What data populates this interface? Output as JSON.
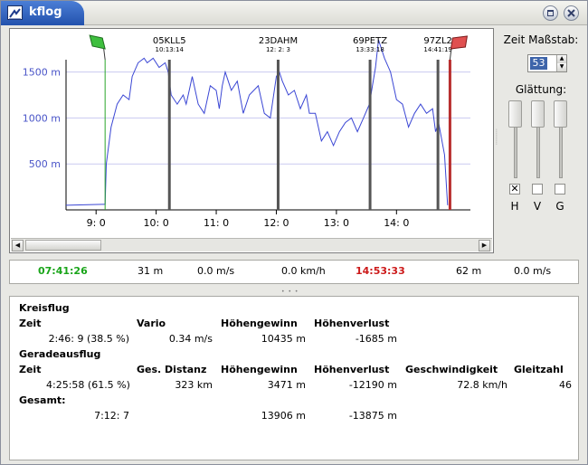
{
  "window": {
    "title": "kflog"
  },
  "chart_data": {
    "type": "line",
    "title": "",
    "y_ticks": [
      {
        "value": 500,
        "label": "500 m"
      },
      {
        "value": 1000,
        "label": "1000 m"
      },
      {
        "value": 1500,
        "label": "1500 m"
      }
    ],
    "x_ticks": [
      {
        "value": 9,
        "label": "9: 0"
      },
      {
        "value": 10,
        "label": "10: 0"
      },
      {
        "value": 11,
        "label": "11: 0"
      },
      {
        "value": 12,
        "label": "12: 0"
      },
      {
        "value": 13,
        "label": "13: 0"
      },
      {
        "value": 14,
        "label": "14: 0"
      }
    ],
    "ylim": [
      0,
      1850
    ],
    "xlim": [
      8.5,
      15.23
    ],
    "grid": true,
    "waypoints": [
      {
        "name": "05KLL5",
        "time": "10:13:14",
        "hour": 10.22
      },
      {
        "name": "23DAHM",
        "time": "12: 2: 3",
        "hour": 12.03
      },
      {
        "name": "69PETZ",
        "time": "13:33:18",
        "hour": 13.56
      },
      {
        "name": "97ZL2",
        "time": "14:41:19",
        "hour": 14.69
      }
    ],
    "start": {
      "hour": 9.15
    },
    "finish": {
      "hour": 14.89
    },
    "series": [
      {
        "points": [
          [
            8.5,
            50
          ],
          [
            9.1,
            60
          ],
          [
            9.15,
            60
          ],
          [
            9.17,
            500
          ],
          [
            9.25,
            900
          ],
          [
            9.35,
            1150
          ],
          [
            9.45,
            1250
          ],
          [
            9.55,
            1200
          ],
          [
            9.6,
            1450
          ],
          [
            9.7,
            1600
          ],
          [
            9.8,
            1650
          ],
          [
            9.85,
            1600
          ],
          [
            9.95,
            1650
          ],
          [
            10.05,
            1550
          ],
          [
            10.15,
            1600
          ],
          [
            10.2,
            1500
          ],
          [
            10.25,
            1250
          ],
          [
            10.35,
            1150
          ],
          [
            10.45,
            1250
          ],
          [
            10.5,
            1150
          ],
          [
            10.55,
            1300
          ],
          [
            10.6,
            1450
          ],
          [
            10.7,
            1150
          ],
          [
            10.8,
            1050
          ],
          [
            10.9,
            1350
          ],
          [
            11,
            1300
          ],
          [
            11.05,
            1100
          ],
          [
            11.1,
            1350
          ],
          [
            11.15,
            1500
          ],
          [
            11.25,
            1300
          ],
          [
            11.35,
            1400
          ],
          [
            11.45,
            1050
          ],
          [
            11.55,
            1250
          ],
          [
            11.7,
            1350
          ],
          [
            11.8,
            1050
          ],
          [
            11.9,
            1000
          ],
          [
            12,
            1450
          ],
          [
            12.05,
            1500
          ],
          [
            12.1,
            1400
          ],
          [
            12.2,
            1250
          ],
          [
            12.3,
            1300
          ],
          [
            12.4,
            1100
          ],
          [
            12.5,
            1250
          ],
          [
            12.55,
            1050
          ],
          [
            12.65,
            1050
          ],
          [
            12.75,
            750
          ],
          [
            12.85,
            850
          ],
          [
            12.95,
            700
          ],
          [
            13.05,
            850
          ],
          [
            13.15,
            950
          ],
          [
            13.25,
            1000
          ],
          [
            13.35,
            850
          ],
          [
            13.45,
            1000
          ],
          [
            13.55,
            1150
          ],
          [
            13.6,
            1350
          ],
          [
            13.65,
            1550
          ],
          [
            13.7,
            1850
          ],
          [
            13.8,
            1650
          ],
          [
            13.9,
            1500
          ],
          [
            14,
            1200
          ],
          [
            14.1,
            1150
          ],
          [
            14.2,
            900
          ],
          [
            14.3,
            1050
          ],
          [
            14.4,
            1150
          ],
          [
            14.5,
            1050
          ],
          [
            14.6,
            1100
          ],
          [
            14.65,
            850
          ],
          [
            14.7,
            950
          ],
          [
            14.8,
            600
          ],
          [
            14.85,
            50
          ]
        ]
      }
    ]
  },
  "right_panel": {
    "zeit_label": "Zeit Maßstab:",
    "zeit_value": "53",
    "glaettung_label": "Glättung:",
    "checkboxes": [
      {
        "label": "H",
        "checked": true,
        "mark": "✕"
      },
      {
        "label": "V",
        "checked": false,
        "mark": ""
      },
      {
        "label": "G",
        "checked": false,
        "mark": ""
      }
    ]
  },
  "status": {
    "time_start": "07:41:26",
    "alt": "31 m",
    "vario": "0.0 m/s",
    "speed": "0.0 km/h",
    "time_end": "14:53:33",
    "alt2": "62 m",
    "vario2": "0.0 m/s",
    "colors": {
      "start": "#1aa51a",
      "end": "#cc1a1a"
    }
  },
  "summary": {
    "kreisflug_title": "Kreisflug",
    "kreisflug_headers": {
      "zeit": "Zeit",
      "vario": "Vario",
      "hoehengewinn": "Höhengewinn",
      "hoehenverlust": "Höhenverlust"
    },
    "kreisflug_values": {
      "zeit": "2:46: 9 (38.5 %)",
      "vario": "0.34 m/s",
      "hoehengewinn": "10435 m",
      "hoehenverlust": "-1685 m"
    },
    "gerade_title": "Geradeausflug",
    "gerade_headers": {
      "zeit": "Zeit",
      "distanz": "Ges. Distanz",
      "hoehengewinn": "Höhengewinn",
      "hoehenverlust": "Höhenverlust",
      "geschwindigkeit": "Geschwindigkeit",
      "gleitzahl": "Gleitzahl"
    },
    "gerade_values": {
      "zeit": "4:25:58 (61.5 %)",
      "distanz": "323 km",
      "hoehengewinn": "3471 m",
      "hoehenverlust": "-12190 m",
      "geschwindigkeit": "72.8 km/h",
      "gleitzahl": "46"
    },
    "gesamt_title": "Gesamt:",
    "gesamt_values": {
      "zeit": "7:12: 7",
      "hoehengewinn": "13906 m",
      "hoehenverlust": "-13875 m"
    }
  }
}
